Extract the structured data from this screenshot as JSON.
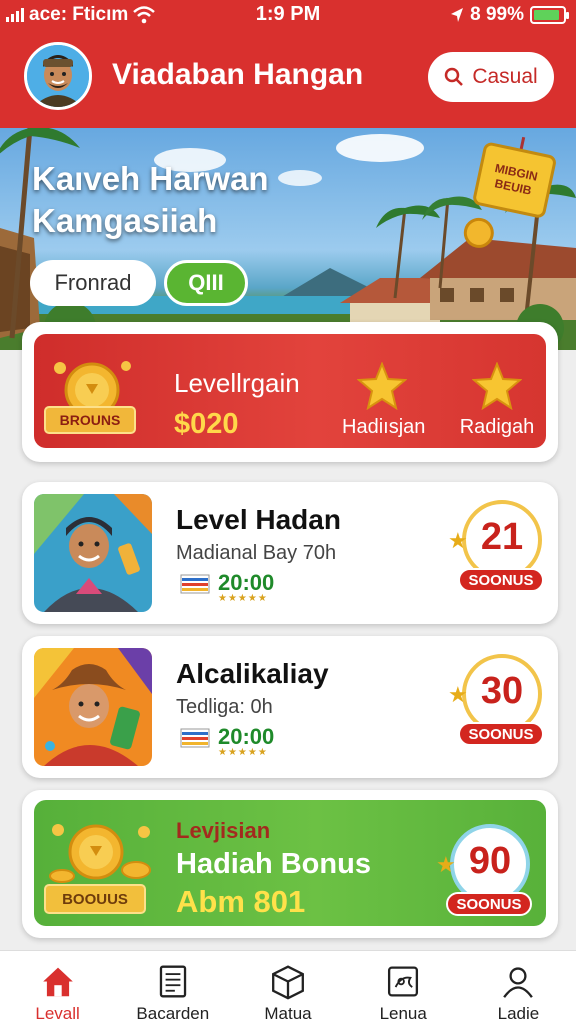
{
  "status_bar": {
    "carrier": "ace: Fticım",
    "time": "1:9 PM",
    "battery_text": "8 99%",
    "battery_level": 0.9
  },
  "header": {
    "app_title": "Viadaban Hangan",
    "search_label": "Casual"
  },
  "hero": {
    "title_line1": "Kaıveh Harwan",
    "title_line2": "Kamgasiiah",
    "filter_chip": "Fronrad",
    "toggle_chip": "QIII",
    "tag_text": "MIBGIN BEUIB"
  },
  "level_card": {
    "bonus_plate": "BROUNS",
    "label": "Levellrgain",
    "amount": "$020",
    "rewards": [
      {
        "label": "Hadiısjan",
        "icon": "star-icon"
      },
      {
        "label": "Radigah",
        "icon": "star-icon"
      }
    ]
  },
  "games": [
    {
      "title": "Level Hadan",
      "subtitle": "Madianal Bay 70h",
      "time": "20:00",
      "stars": "★★★★★",
      "score": "21",
      "score_label": "SOONUS"
    },
    {
      "title": "Alcalikaliay",
      "subtitle": "Tedliga: 0h",
      "time": "20:00",
      "stars": "★★★★★",
      "score": "30",
      "score_label": "SOONUS"
    }
  ],
  "bonus_card": {
    "plate": "BOOUUS",
    "subtitle": "Levjisian",
    "title": "Hadiah Bonus",
    "amount": "Abm 801",
    "score": "90",
    "score_label": "SOONUS"
  },
  "bottom_nav": [
    {
      "label": "Levall",
      "icon": "home-icon",
      "active": true
    },
    {
      "label": "Bacarden",
      "icon": "document-icon",
      "active": false
    },
    {
      "label": "Matua",
      "icon": "box-icon",
      "active": false
    },
    {
      "label": "Lenua",
      "icon": "gift-icon",
      "active": false
    },
    {
      "label": "Ladie",
      "icon": "user-icon",
      "active": false
    }
  ],
  "colors": {
    "primary_red": "#d9302e",
    "bonus_green": "#5ab532",
    "gold": "#f2b72d"
  }
}
